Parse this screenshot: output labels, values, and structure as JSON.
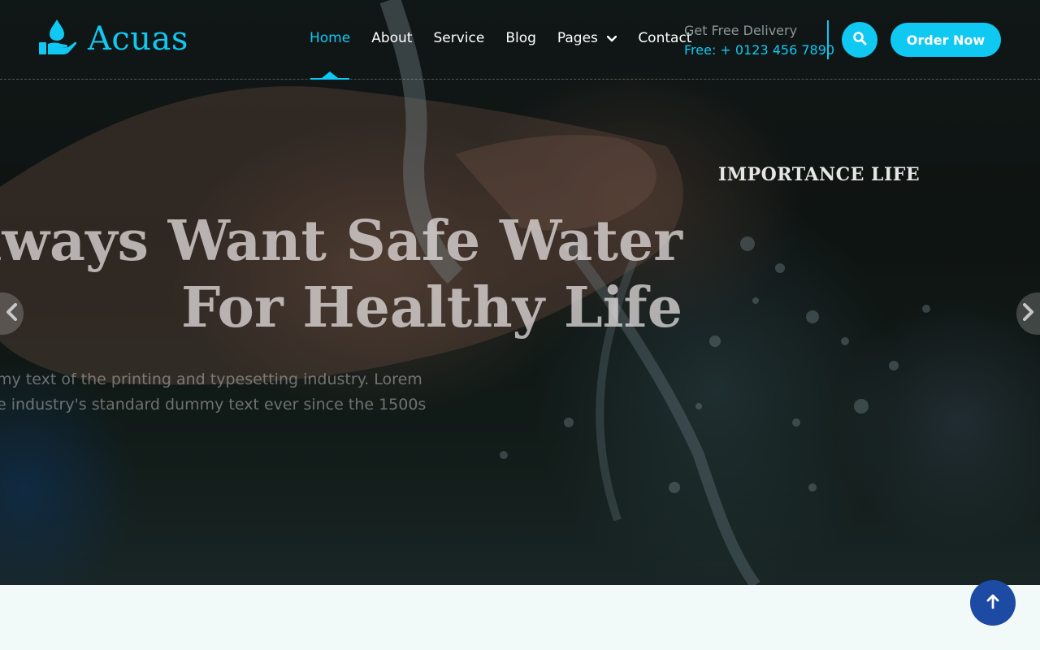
{
  "brand": {
    "name": "Acuas"
  },
  "nav": {
    "items": [
      {
        "label": "Home",
        "active": true
      },
      {
        "label": "About"
      },
      {
        "label": "Service"
      },
      {
        "label": "Blog"
      },
      {
        "label": "Pages",
        "has_dropdown": true
      },
      {
        "label": "Contact"
      }
    ]
  },
  "delivery": {
    "label": "Get Free Delivery",
    "phone": "Free: + 0123 456 7890"
  },
  "header_actions": {
    "search_icon": "search-icon",
    "order_label": "Order Now"
  },
  "hero": {
    "subtitle": "IMPORTANCE LIFE",
    "headline_line1": "Always Want Safe Water",
    "headline_line2": "For Healthy Life",
    "description_line1": "my text of the printing and typesetting industry. Lorem",
    "description_line2": "e industry's standard dummy text ever since the 1500s"
  },
  "controls": {
    "prev_icon": "chevron-left-icon",
    "next_icon": "chevron-right-icon",
    "back_to_top_icon": "arrow-up-icon"
  },
  "colors": {
    "accent": "#0fc9f2",
    "back_to_top": "#1d4aa3",
    "page_background": "#f2f9f9"
  }
}
